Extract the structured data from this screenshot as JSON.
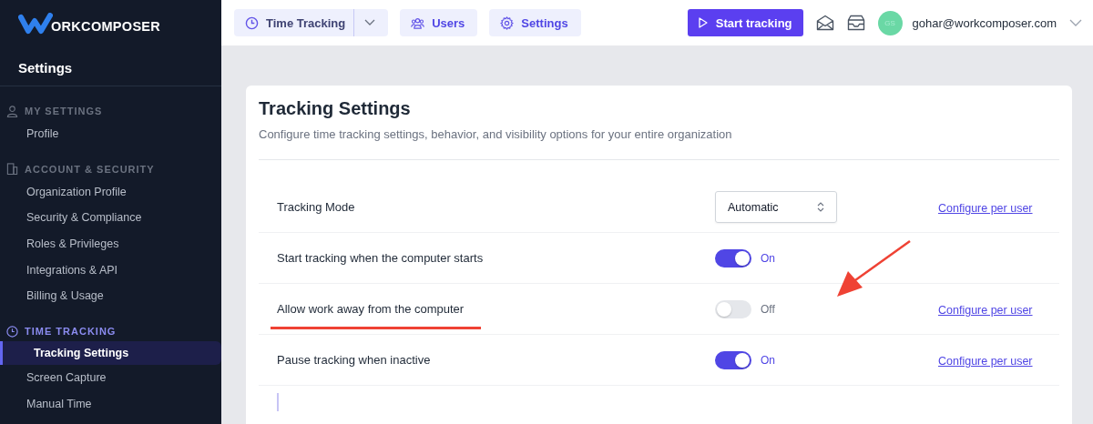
{
  "logo": {
    "text": "ORKCOMPOSER"
  },
  "sidebar": {
    "title": "Settings",
    "sections": [
      {
        "label": "MY SETTINGS",
        "active": false,
        "items": [
          {
            "label": "Profile",
            "selected": false
          }
        ]
      },
      {
        "label": "ACCOUNT & SECURITY",
        "active": false,
        "items": [
          {
            "label": "Organization Profile",
            "selected": false
          },
          {
            "label": "Security & Compliance",
            "selected": false
          },
          {
            "label": "Roles & Privileges",
            "selected": false
          },
          {
            "label": "Integrations & API",
            "selected": false
          },
          {
            "label": "Billing & Usage",
            "selected": false
          }
        ]
      },
      {
        "label": "TIME TRACKING",
        "active": true,
        "items": [
          {
            "label": "Tracking Settings",
            "selected": true
          },
          {
            "label": "Screen Capture",
            "selected": false
          },
          {
            "label": "Manual Time",
            "selected": false
          }
        ]
      }
    ]
  },
  "topbar": {
    "nav": [
      {
        "label": "Time Tracking",
        "dropdown": true
      },
      {
        "label": "Users",
        "dropdown": false
      },
      {
        "label": "Settings",
        "dropdown": false
      }
    ],
    "start_button": "Start tracking",
    "avatar": "GS",
    "email": "gohar@workcomposer.com"
  },
  "card": {
    "title": "Tracking Settings",
    "description": "Configure time tracking settings, behavior, and visibility options for your entire organization",
    "rows": [
      {
        "label": "Tracking Mode",
        "kind": "select",
        "value": "Automatic",
        "link": "Configure per user",
        "annotated": false
      },
      {
        "label": "Start tracking when the computer starts",
        "kind": "toggle",
        "on": true,
        "state": "On",
        "annotated": false
      },
      {
        "label": "Allow work away from the computer",
        "kind": "toggle",
        "on": false,
        "state": "Off",
        "link": "Configure per user",
        "annotated": true
      },
      {
        "label": "Pause tracking when inactive",
        "kind": "toggle",
        "on": true,
        "state": "On",
        "link": "Configure per user",
        "annotated": false
      }
    ]
  }
}
